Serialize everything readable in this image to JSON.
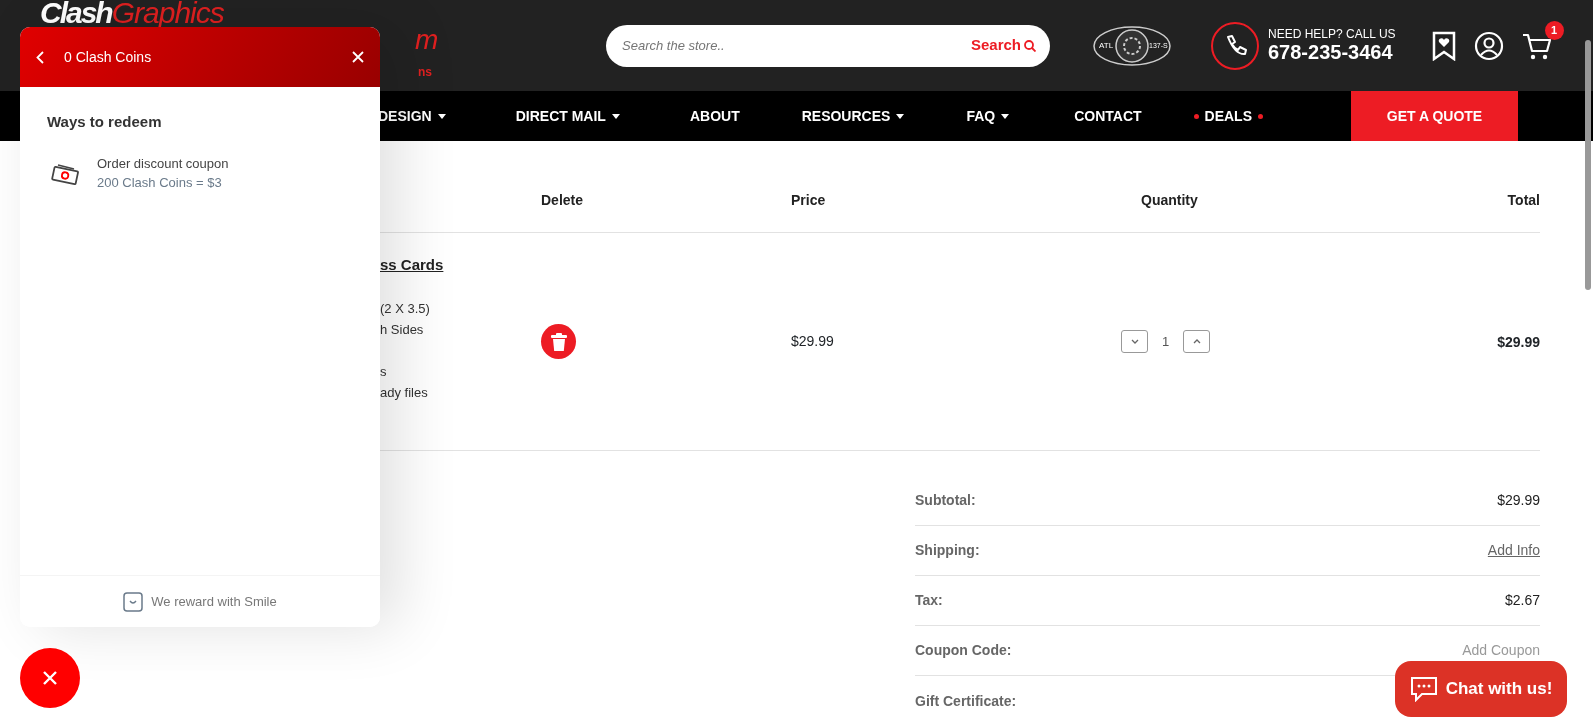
{
  "header": {
    "logo": {
      "brand_white": "Clash",
      "brand_red": "Graphics",
      "fragment": "m",
      "tagline_fragment": "ns"
    },
    "search": {
      "placeholder": "Search the store..",
      "button": "Search"
    },
    "emblem": {
      "left": "ATL",
      "right": "137-S"
    },
    "help_label": "NEED HELP? CALL US",
    "phone": "678-235-3464",
    "cart_count": "1"
  },
  "nav": [
    {
      "label": "DESIGN",
      "kind": "link",
      "dropdown": true
    },
    {
      "label": "DIRECT MAIL",
      "kind": "link",
      "dropdown": true
    },
    {
      "label": "ABOUT",
      "kind": "link",
      "dropdown": false
    },
    {
      "label": "RESOURCES",
      "kind": "link",
      "dropdown": true
    },
    {
      "label": "FAQ",
      "kind": "link",
      "dropdown": true
    },
    {
      "label": "CONTACT",
      "kind": "link",
      "dropdown": false
    },
    {
      "label": "DEALS",
      "kind": "deals",
      "dropdown": false
    },
    {
      "label": "GET A QUOTE",
      "kind": "cta"
    }
  ],
  "cart": {
    "columns": [
      "Delete",
      "Price",
      "Quantity",
      "Total"
    ],
    "rows": [
      {
        "product_title": "ss Cards",
        "product_line_groups": [
          [
            "(2 X 3.5)",
            "h Sides"
          ],
          [
            "s",
            "ady files"
          ]
        ],
        "price": "$29.99",
        "quantity": "1",
        "total": "$29.99"
      }
    ]
  },
  "summary": [
    {
      "label": "Subtotal:",
      "value": "$29.99",
      "kind": "text"
    },
    {
      "label": "Shipping:",
      "value": "Add Info",
      "kind": "link"
    },
    {
      "label": "Tax:",
      "value": "$2.67",
      "kind": "text"
    },
    {
      "label": "Coupon Code:",
      "value": "Add Coupon",
      "kind": "muted-link"
    },
    {
      "label": "Gift Certificate:",
      "kind": "none"
    }
  ],
  "rewards_panel": {
    "title": "0 Clash Coins",
    "section": "Ways to redeem",
    "items": [
      {
        "title": "Order discount coupon",
        "subtitle": "200 Clash Coins = $3"
      }
    ],
    "footer": "We reward with Smile"
  },
  "chat_button": "Chat with us!"
}
